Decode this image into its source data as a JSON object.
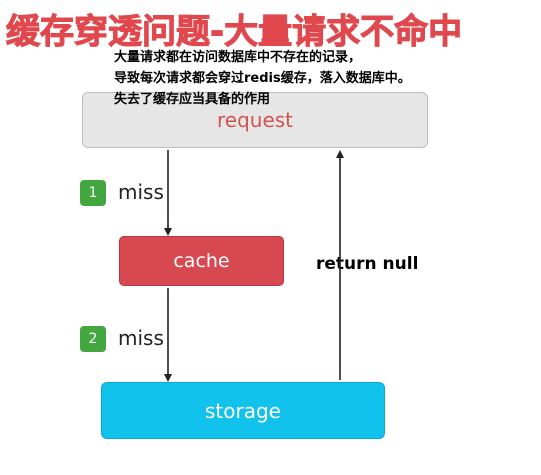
{
  "title": "缓存穿透问题-大量请求不命中",
  "note": {
    "lines": [
      "大量请求都在访问数据库中不存在的记录，",
      "导致每次请求都会穿过redis缓存，落入数据库中。",
      "失去了缓存应当具备的作用"
    ]
  },
  "nodes": {
    "request": "request",
    "cache": "cache",
    "storage": "storage"
  },
  "steps": [
    {
      "number": "1",
      "label": "miss"
    },
    {
      "number": "2",
      "label": "miss"
    }
  ],
  "return_label": "return null",
  "colors": {
    "title": "#e0484e",
    "request_fill": "#e6e6e6",
    "request_text": "#d0544f",
    "cache_fill": "#d84850",
    "storage_fill": "#11c2ec",
    "badge": "#43a73f"
  }
}
